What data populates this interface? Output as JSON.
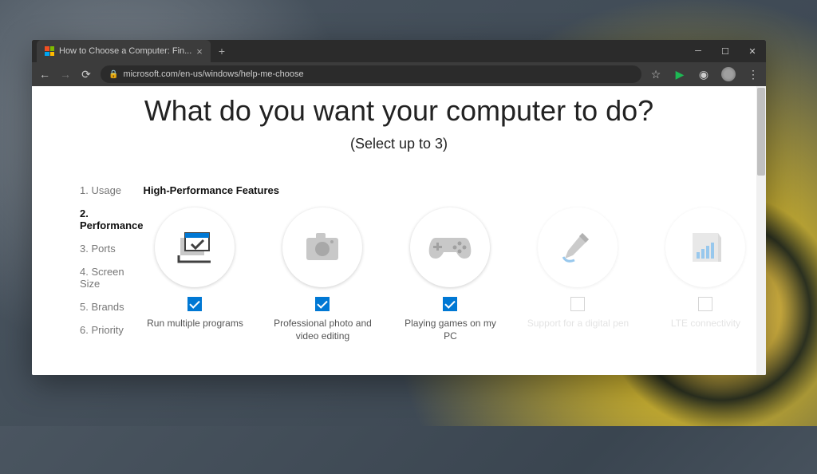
{
  "browser": {
    "tab_title": "How to Choose a Computer: Fin...",
    "url": "microsoft.com/en-us/windows/help-me-choose"
  },
  "page": {
    "heading": "What do you want your computer to do?",
    "subheading": "(Select up to 3)"
  },
  "sidebar": {
    "items": [
      {
        "label": "1. Usage",
        "active": false
      },
      {
        "label": "2. Performance",
        "active": true
      },
      {
        "label": "3. Ports",
        "active": false
      },
      {
        "label": "4. Screen Size",
        "active": false
      },
      {
        "label": "5. Brands",
        "active": false
      },
      {
        "label": "6. Priority",
        "active": false
      }
    ]
  },
  "section": {
    "title": "High-Performance Features",
    "options": [
      {
        "label": "Run multiple programs",
        "icon": "multitask",
        "selected": true,
        "enabled": true
      },
      {
        "label": "Professional photo and video editing",
        "icon": "camera",
        "selected": true,
        "enabled": true
      },
      {
        "label": "Playing games on my PC",
        "icon": "gamepad",
        "selected": true,
        "enabled": true
      },
      {
        "label": "Support for a digital pen",
        "icon": "pen",
        "selected": false,
        "enabled": false
      },
      {
        "label": "LTE connectivity",
        "icon": "signal",
        "selected": false,
        "enabled": false
      }
    ]
  }
}
